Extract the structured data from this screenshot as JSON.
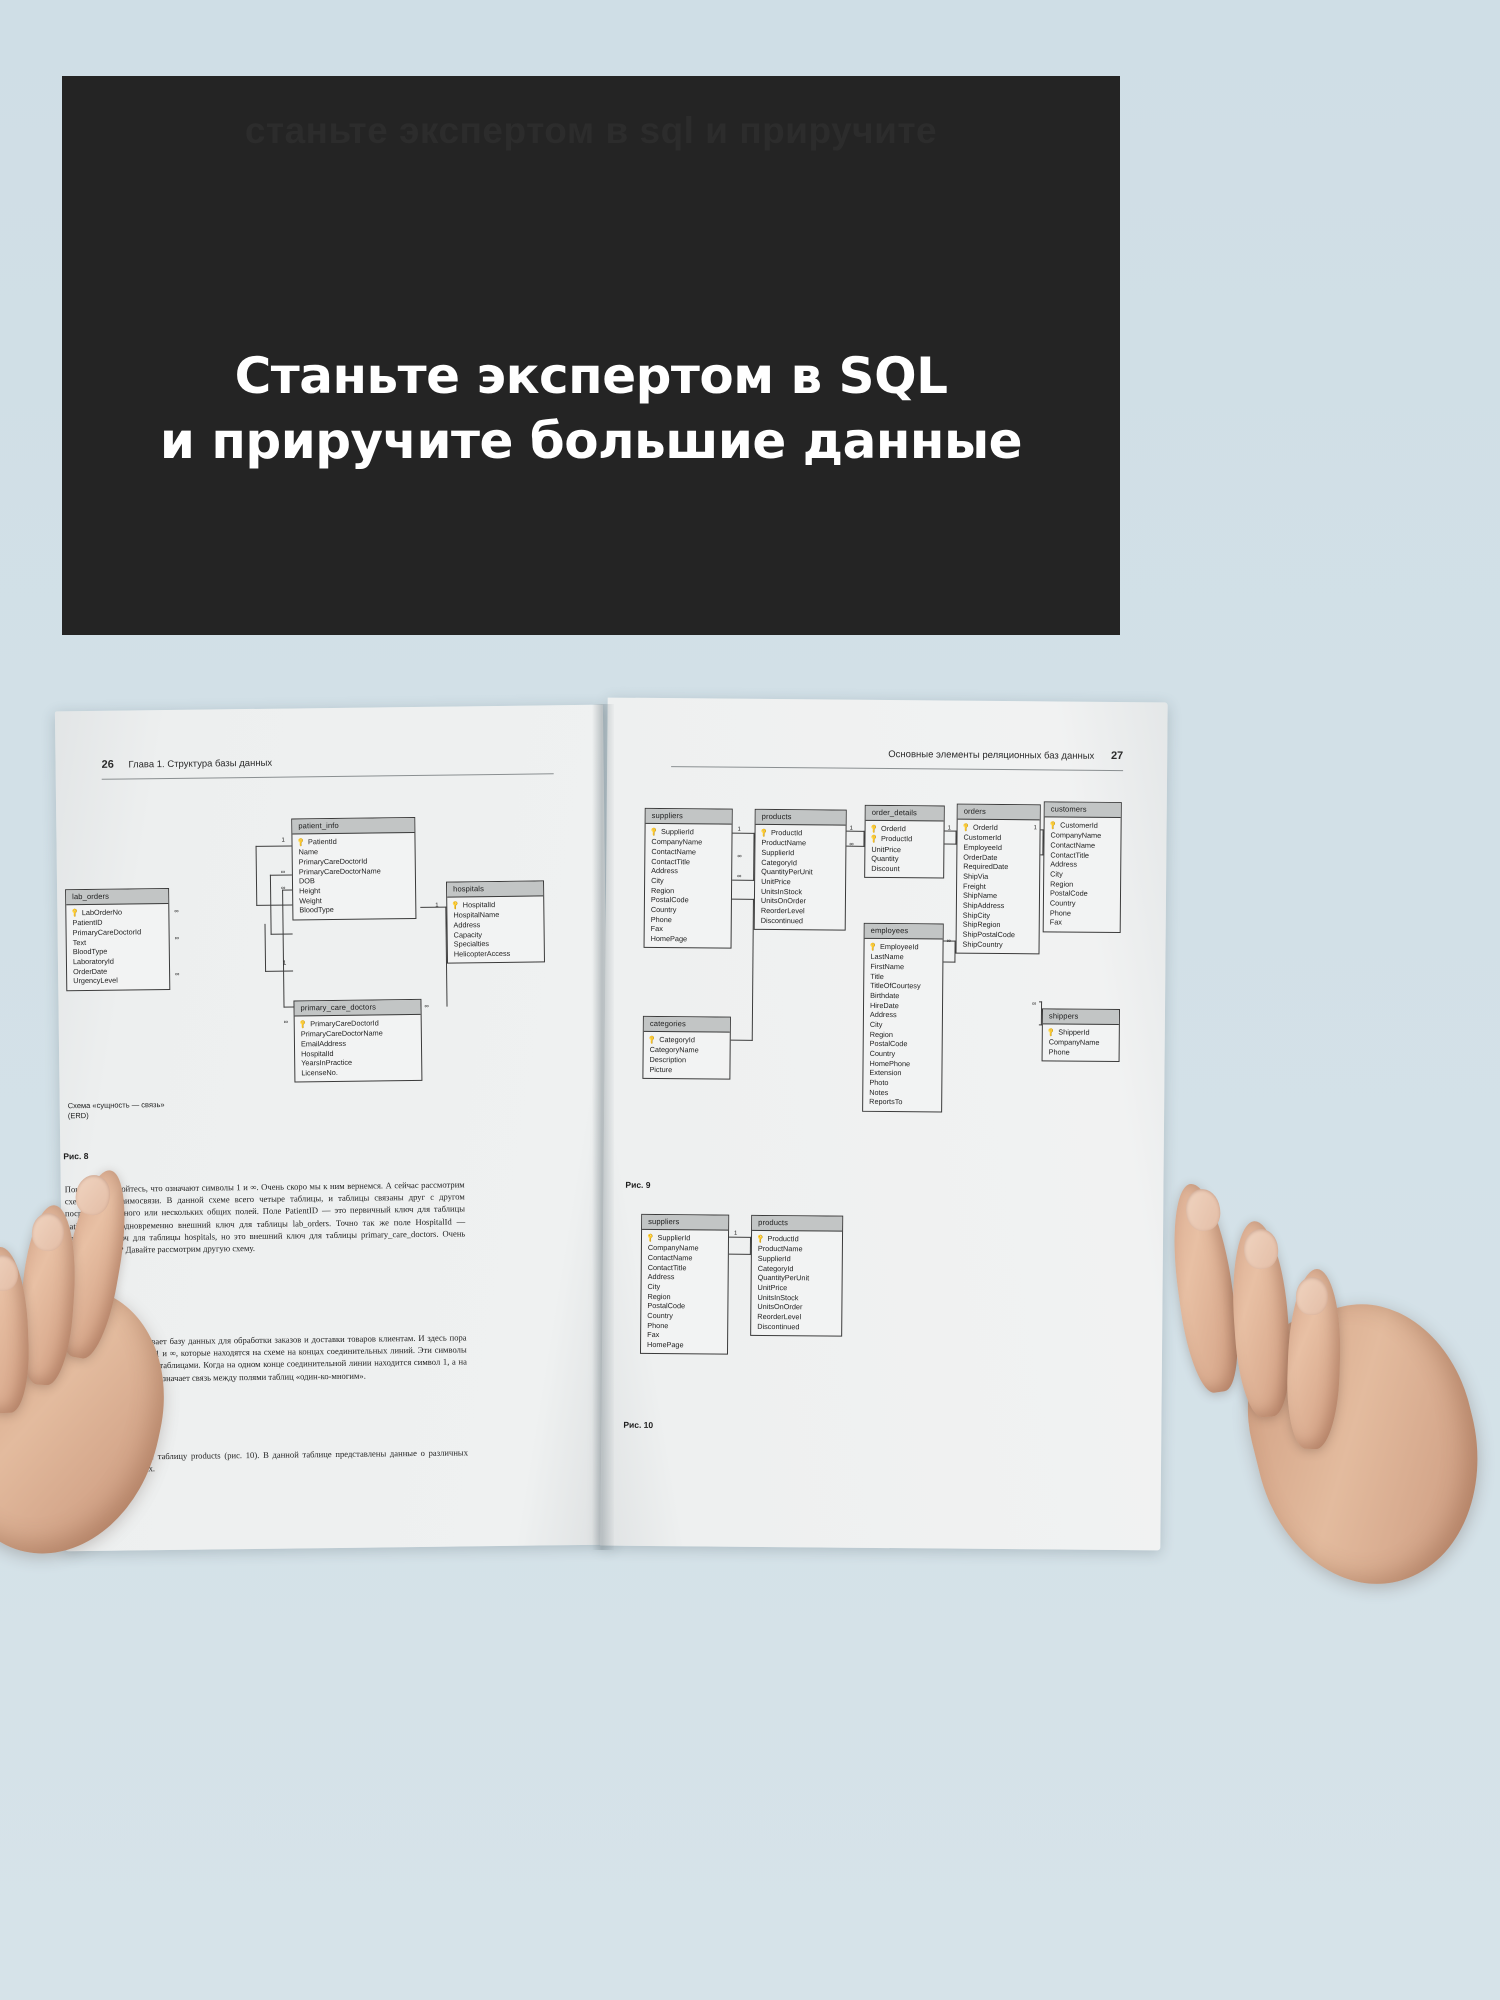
{
  "banner": {
    "watermark": "станьте экспертом в sql и приручите",
    "headline_line1": "Станьте экспертом в SQL",
    "headline_line2": "и приручите большие данные",
    "bg_color": "#242424",
    "text_color": "#ffffff"
  },
  "page_left": {
    "page_number": "26",
    "running_head": "Глава 1. Структура базы данных",
    "figure_caption": "Рис. 8",
    "schema_label_line1": "Схема «сущность — связь»",
    "schema_label_line2": "(ERD)",
    "paragraphs": [
      "Пока не беспокойтесь, что означают символы 1 и ∞. Очень скоро мы к ним вернемся. А сейчас рассмотрим схему и ее взаимосвязи. В данной схеме всего четыре таблицы, и таблицы связаны друг с другом посредством одного или нескольких общих полей. Поле PatientID — это первичный ключ для таблицы patient_info и одновременно внешний ключ для таблицы lab_orders. Точно так же поле HospitalId — первичный ключ для таблицы hospitals, но это внешний ключ для таблицы primary_care_doctors. Очень просто, правда? Давайте рассмотрим другую схему.",
      "Схема на рис. 9 описывает базу данных для обработки заказов и доставки товаров клиентам. И здесь пора поговорить о символах 1 и ∞, которые находятся на схеме на концах соединительных линий. Эти символы описывают связи между таблицами. Когда на одном конце соединительной линии находится символ 1, а на другом — символ ∞, это означает связь между полями таблиц «один-ко-многим».",
      "Рассмотрим подробнее таблицу products (рис. 10). В данной таблице представлены данные о различных товарах и их атрибутах."
    ],
    "erd_tables": [
      {
        "name": "patient_info",
        "fields": [
          "PatientId",
          "Name",
          "PrimaryCareDoctorId",
          "PrimaryCareDoctorName",
          "DOB",
          "Height",
          "Weight",
          "BloodType"
        ],
        "pk_count": 1
      },
      {
        "name": "lab_orders",
        "fields": [
          "LabOrderNo",
          "PatientID",
          "PrimaryCareDoctorId",
          "Text",
          "BloodType",
          "LaboratoryId",
          "OrderDate",
          "UrgencyLevel"
        ],
        "pk_count": 1
      },
      {
        "name": "primary_care_doctors",
        "fields": [
          "PrimaryCareDoctorId",
          "PrimaryCareDoctorName",
          "EmailAddress",
          "HospitalId",
          "YearsInPractice",
          "LicenseNo."
        ],
        "pk_count": 1
      },
      {
        "name": "hospitals",
        "fields": [
          "HospitalId",
          "HospitalName",
          "Address",
          "Capacity",
          "Specialties",
          "HelicopterAccess"
        ],
        "pk_count": 1
      }
    ],
    "cardinalities": [
      "1",
      "∞",
      "∞",
      "∞",
      "∞",
      "∞",
      "1",
      "∞",
      "1",
      "∞"
    ]
  },
  "page_right": {
    "page_number": "27",
    "running_head": "Основные элементы реляционных баз данных",
    "figure_caption_9": "Рис. 9",
    "figure_caption_10": "Рис. 10",
    "erd_tables_fig9": [
      {
        "name": "suppliers",
        "fields": [
          "SupplierId",
          "CompanyName",
          "ContactName",
          "ContactTitle",
          "Address",
          "City",
          "Region",
          "PostalCode",
          "Country",
          "Phone",
          "Fax",
          "HomePage"
        ],
        "pk_count": 1
      },
      {
        "name": "categories",
        "fields": [
          "CategoryId",
          "CategoryName",
          "Description",
          "Picture"
        ],
        "pk_count": 1
      },
      {
        "name": "products",
        "fields": [
          "ProductId",
          "ProductName",
          "SupplierId",
          "CategoryId",
          "QuantityPerUnit",
          "UnitPrice",
          "UnitsInStock",
          "UnitsOnOrder",
          "ReorderLevel",
          "Discontinued"
        ],
        "pk_count": 1
      },
      {
        "name": "order_details",
        "fields": [
          "OrderId",
          "ProductId",
          "UnitPrice",
          "Quantity",
          "Discount"
        ],
        "pk_count": 2
      },
      {
        "name": "orders",
        "fields": [
          "OrderId",
          "CustomerId",
          "EmployeeId",
          "OrderDate",
          "RequiredDate",
          "ShipVia",
          "Freight",
          "ShipName",
          "ShipAddress",
          "ShipCity",
          "ShipRegion",
          "ShipPostalCode",
          "ShipCountry"
        ],
        "pk_count": 1
      },
      {
        "name": "employees",
        "fields": [
          "EmployeeId",
          "LastName",
          "FirstName",
          "Title",
          "TitleOfCourtesy",
          "Birthdate",
          "HireDate",
          "Address",
          "City",
          "Region",
          "PostalCode",
          "Country",
          "HomePhone",
          "Extension",
          "Photo",
          "Notes",
          "ReportsTo"
        ],
        "pk_count": 1
      },
      {
        "name": "customers",
        "fields": [
          "CustomerId",
          "CompanyName",
          "ContactName",
          "ContactTitle",
          "Address",
          "City",
          "Region",
          "PostalCode",
          "Country",
          "Phone",
          "Fax"
        ],
        "pk_count": 1
      },
      {
        "name": "shippers",
        "fields": [
          "ShipperId",
          "CompanyName",
          "Phone"
        ],
        "pk_count": 1
      }
    ],
    "erd_tables_fig10": [
      {
        "name": "suppliers",
        "fields": [
          "SupplierId",
          "CompanyName",
          "ContactName",
          "ContactTitle",
          "Address",
          "City",
          "Region",
          "PostalCode",
          "Country",
          "Phone",
          "Fax",
          "HomePage"
        ],
        "pk_count": 1
      },
      {
        "name": "products",
        "fields": [
          "ProductId",
          "ProductName",
          "SupplierId",
          "CategoryId",
          "QuantityPerUnit",
          "UnitPrice",
          "UnitsInStock",
          "UnitsOnOrder",
          "ReorderLevel",
          "Discontinued"
        ],
        "pk_count": 1
      }
    ],
    "cardinalities": [
      "1",
      "∞",
      "∞",
      "1",
      "∞",
      "1",
      "∞",
      "1",
      "∞",
      "∞"
    ]
  },
  "background_color": "#d3e0e7"
}
